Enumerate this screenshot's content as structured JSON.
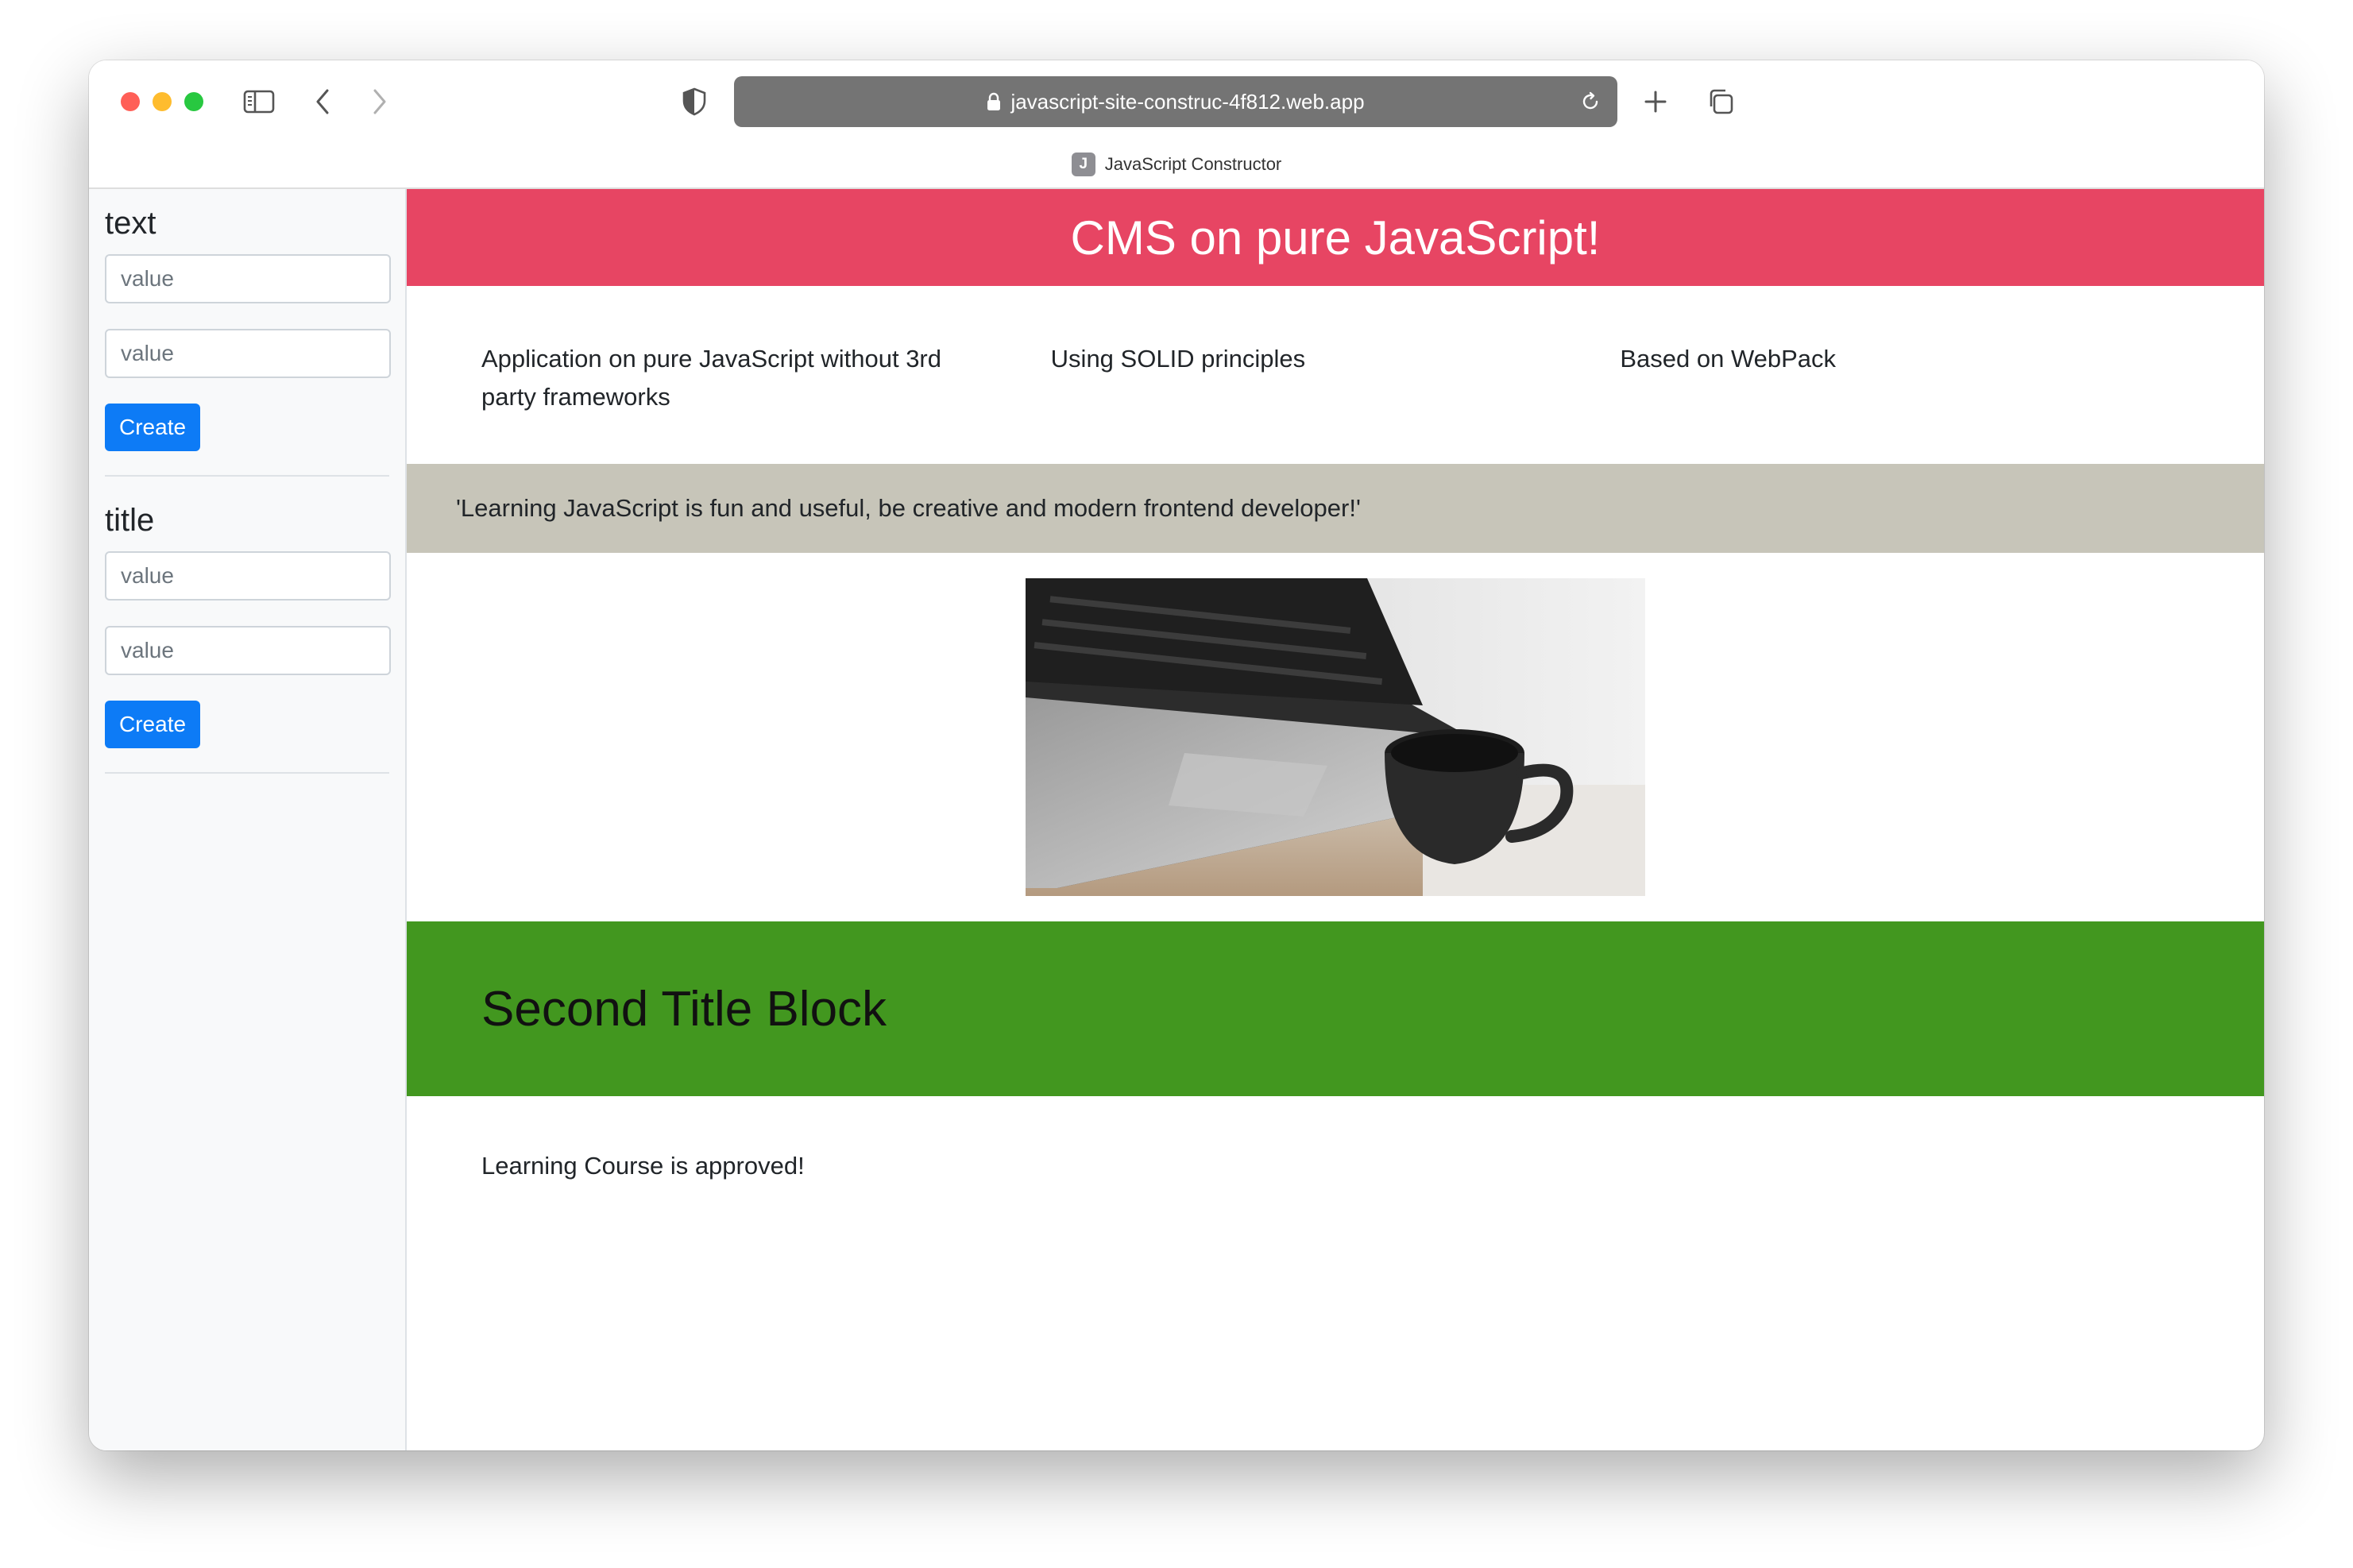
{
  "browser": {
    "url": "javascript-site-construc-4f812.web.app",
    "tab": {
      "favicon_letter": "J",
      "title": "JavaScript Constructor"
    }
  },
  "sidebar": {
    "forms": [
      {
        "heading": "text",
        "inputs": [
          {
            "placeholder": "value"
          },
          {
            "placeholder": "value"
          }
        ],
        "button_label": "Create"
      },
      {
        "heading": "title",
        "inputs": [
          {
            "placeholder": "value"
          },
          {
            "placeholder": "value"
          }
        ],
        "button_label": "Create"
      }
    ]
  },
  "content": {
    "hero_title": "CMS on pure JavaScript!",
    "hero_color": "#e74563",
    "columns": [
      "Application on pure JavaScript without 3rd party frameworks",
      "Using SOLID principles",
      "Based on WebPack"
    ],
    "quote": "'Learning JavaScript is fun and useful, be creative and modern frontend developer!'",
    "quote_color": "#c7c5b9",
    "second_title": "Second Title Block",
    "second_title_color": "#42971f",
    "plain_text": "Learning Course is approved!"
  },
  "colors": {
    "primary_button": "#0d7bf6",
    "sidebar_bg": "#f8f9fa",
    "address_bar": "#747474"
  }
}
